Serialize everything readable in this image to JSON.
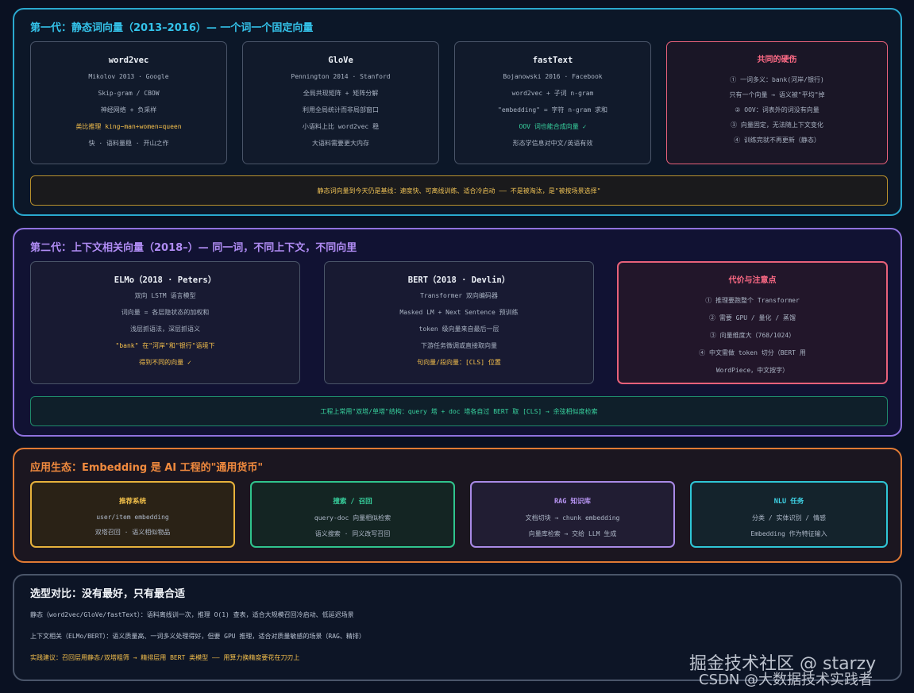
{
  "gen1": {
    "title": "第一代：静态词向量（2013–2016）— 一个词一个固定向量",
    "cards": [
      {
        "title": "word2vec",
        "lines": [
          "Mikolov 2013 · Google",
          "Skip-gram / CBOW",
          "神经网络 + 负采样"
        ],
        "highlight": "类比推理 king−man+women=queen",
        "last": "快 · 语料量稳 · 开山之作"
      },
      {
        "title": "GloVe",
        "lines": [
          "Pennington 2014 · Stanford",
          "全局共现矩阵 + 矩阵分解",
          "利用全局统计而非局部窗口",
          "小语料上比 word2vec 稳",
          "大语料需要更大内存"
        ]
      },
      {
        "title": "fastText",
        "lines": [
          "Bojanowski 2016 · Facebook",
          "word2vec + 子词 n-gram",
          "\"embedding\" = 字符 n-gram 求和"
        ],
        "highlight": "OOV 词也能合成向量 ✓",
        "last": "形态学信息对中文/英语有效"
      }
    ],
    "flaws": {
      "title": "共同的硬伤",
      "items": [
        "① 一词多义：bank(河岸/银行)",
        "只有一个向量 → 语义被\"平均\"掉",
        "② OOV：词表外的词没有向量",
        "③ 向量固定，无法随上下文变化",
        "④ 训练完就不再更新（静态）"
      ]
    },
    "note": "静态词向量到今天仍是基线：速度快、可离线训练、适合冷启动 —— 不是被淘汰，是\"被按场景选择\""
  },
  "gen2": {
    "title": "第二代：上下文相关向量（2018–）— 同一词，不同上下文，不同向里",
    "elmo": {
      "title": "ELMo（2018 · Peters）",
      "lines": [
        "双向 LSTM 语言模型",
        "词向量 = 各层隐状态的加权和",
        "浅层抓语法，深层抓语义"
      ],
      "h1": "\"bank\" 在\"河岸\"和\"银行\"语境下",
      "h2": "得到不同的向量 ✓"
    },
    "bert": {
      "title": "BERT（2018 · Devlin）",
      "lines": [
        "Transformer 双向编码器",
        "Masked LM + Next Sentence 预训练",
        "token 级向量来自最后一层",
        "下游任务微调或直接取向量"
      ],
      "h": "句向量/段向量：[CLS] 位置"
    },
    "cost": {
      "title": "代价与注意点",
      "items": [
        "① 推理要跑整个 Transformer",
        "② 需要 GPU / 量化 / 蒸馏",
        "③ 向量维度大（768/1024）",
        "④ 中文需做 token 切分（BERT 用",
        "WordPiece，中文按字）"
      ]
    },
    "note": "工程上常用\"双塔/单塔\"结构：query 塔 + doc 塔各自过 BERT 取 [CLS] → 余弦相似度检索"
  },
  "eco": {
    "title": "应用生态：Embedding 是 AI 工程的\"通用货币\"",
    "cards": [
      {
        "title": "推荐系统",
        "l1": "user/item embedding",
        "l2": "双塔召回 · 语义相似物品",
        "color": "#e7b23c"
      },
      {
        "title": "搜索 / 召回",
        "l1": "query-doc 向量相似检索",
        "l2": "语义搜索 · 同义改写召回",
        "color": "#30c48d"
      },
      {
        "title": "RAG 知识库",
        "l1": "文档切块 → chunk embedding",
        "l2": "向量库检索 → 交给 LLM 生成",
        "color": "#a98ae6"
      },
      {
        "title": "NLU 任务",
        "l1": "分类 / 实体识别 / 情感",
        "l2": "Embedding 作为特征输入",
        "color": "#2fc6d6"
      }
    ]
  },
  "compare": {
    "title": "选型对比：没有最好，只有最合适",
    "static": "静态（word2vec/GloVe/fastText）：语料离线训一次，推理 O(1) 查表，适合大规模召回冷启动、低延迟场景",
    "contextual": "上下文相关（ELMo/BERT）：语义质量高、一词多义处理得好，但要 GPU 推理，适合对质量敏感的场景（RAG、精排）",
    "advice": "实践建议：召回层用静态/双塔粗筛 → 精排层用 BERT 类模型 —— 用算力换精度要花在刀刃上"
  },
  "watermark": {
    "line1": "掘金技术社区 @ starzy",
    "line2": "CSDN @大数据技术实践者"
  }
}
